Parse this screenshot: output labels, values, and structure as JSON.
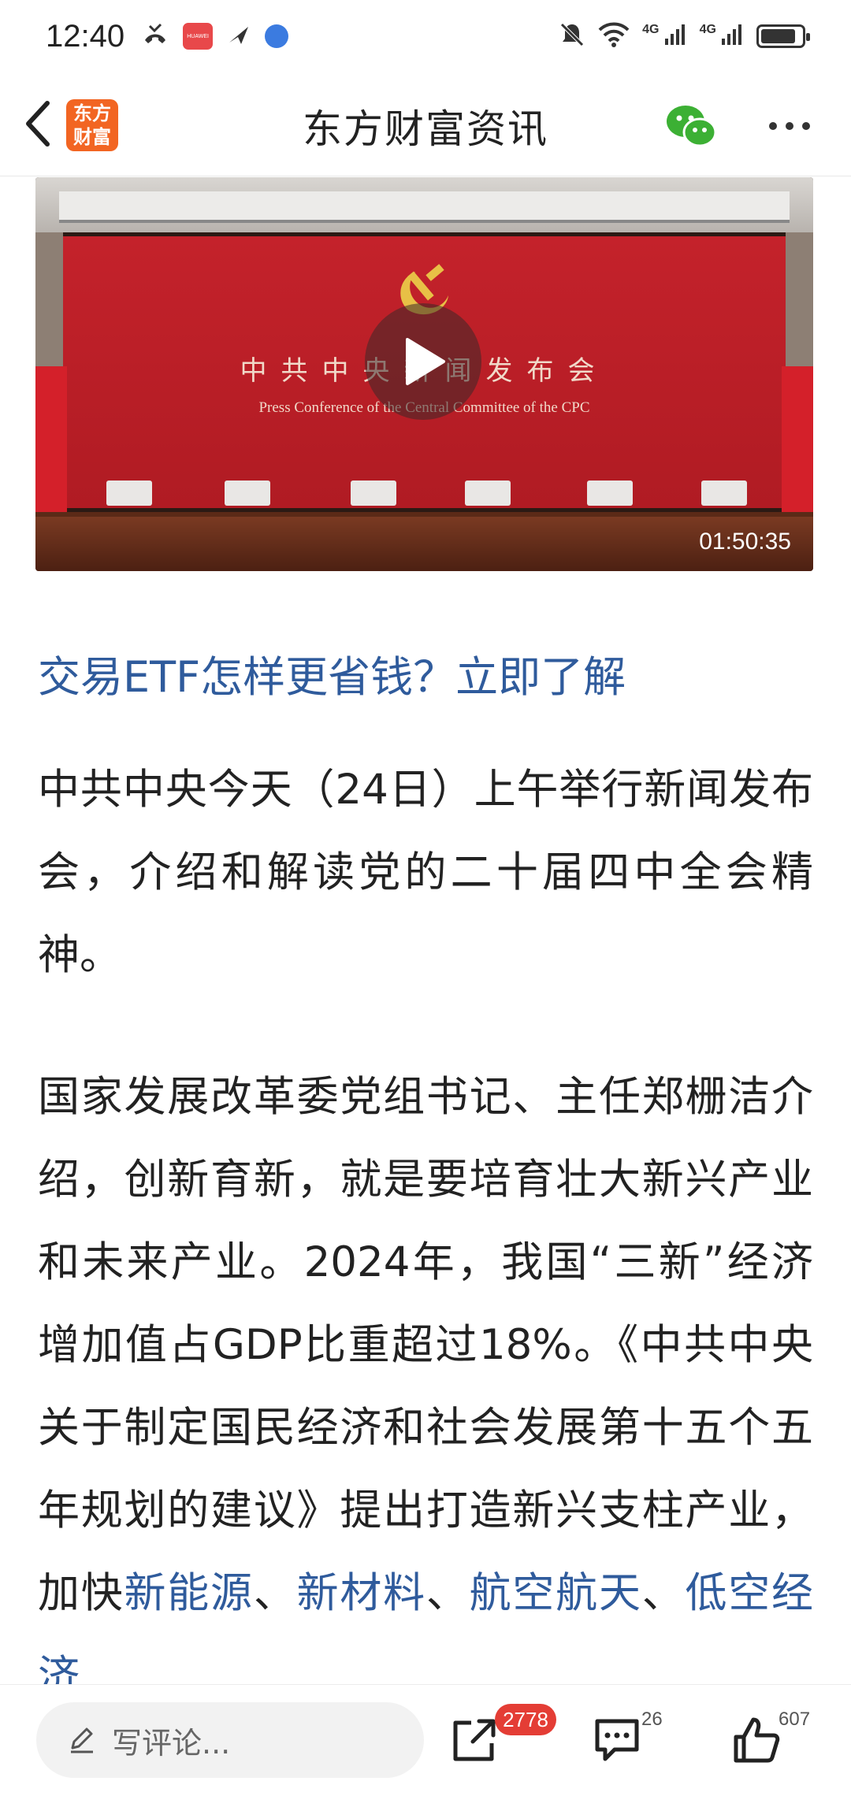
{
  "status_bar": {
    "time": "12:40",
    "huawei_label": "HUAWEI",
    "network_1": "4G",
    "network_2": "4G",
    "battery_level_percent": 85
  },
  "header": {
    "logo_text_line1": "东方",
    "logo_text_line2": "财富",
    "title": "东方财富资讯"
  },
  "video": {
    "banner_cn": "中共中央新闻发布会",
    "banner_en": "Press Conference of the Central Committee of the CPC",
    "duration": "01:50:35"
  },
  "article": {
    "promo_link": "交易ETF怎样更省钱？立即了解",
    "para1": "中共中央今天（24日）上午举行新闻发布会，介绍和解读党的二十届四中全会精神。",
    "para2_text": "国家发展改革委党组书记、主任郑栅洁介绍，创新育新，就是要培育壮大新兴产业和未来产业。2024年，我国“三新”经济增加值占GDP比重超过18%。《中共中央关于制定国民经济和社会发展第十五个五年规划的建议》提出打造新兴支柱产业，加快",
    "keywords": [
      "新能源",
      "新材料",
      "航空航天",
      "低空经济"
    ],
    "separator": "、"
  },
  "bottom_bar": {
    "comment_placeholder": "写评论...",
    "share_count": "2778",
    "comment_count": "26",
    "like_count": "607"
  },
  "icons": {
    "back": "back-arrow-icon",
    "wechat": "wechat-icon",
    "more": "more-dots-icon",
    "play": "play-icon",
    "pencil": "pencil-icon",
    "share": "share-icon",
    "comment": "comment-icon",
    "like": "thumbs-up-icon"
  },
  "colors": {
    "link_blue": "#2f5b9c",
    "logo_orange": "#f26522",
    "badge_red": "#e43d35"
  }
}
